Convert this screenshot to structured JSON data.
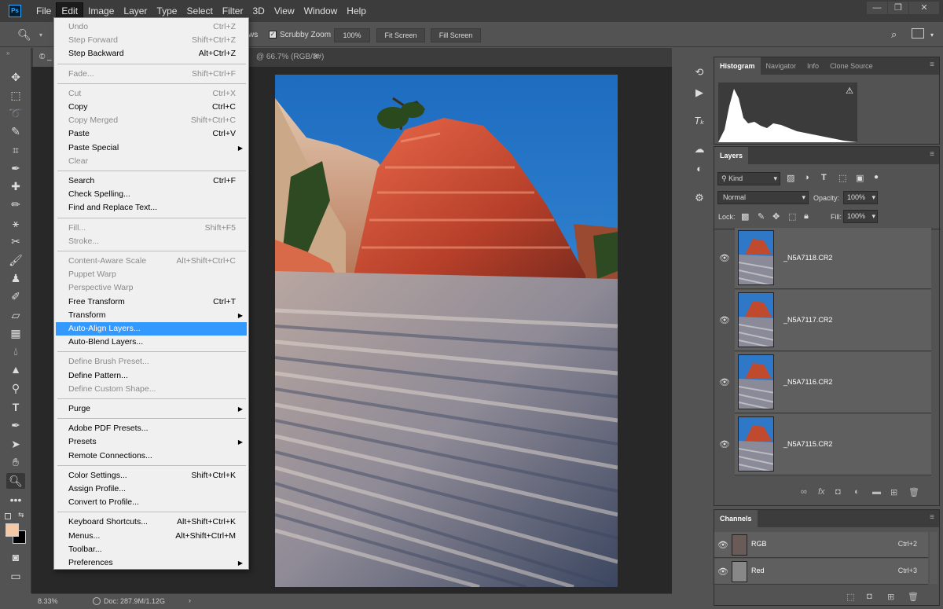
{
  "app": {
    "logo": "Ps"
  },
  "menubar": {
    "items": [
      "File",
      "Edit",
      "Image",
      "Layer",
      "Type",
      "Select",
      "Filter",
      "3D",
      "View",
      "Window",
      "Help"
    ],
    "active": "Edit"
  },
  "window_controls": {
    "minimize": "—",
    "maximize": "❐",
    "close": "✕"
  },
  "options": {
    "windows_label": "ws",
    "scrubby": "Scrubby Zoom",
    "zoom_pct": "100%",
    "fit": "Fit Screen",
    "fill": "Fill Screen"
  },
  "tabs": {
    "doc1": "© _",
    "doc2": "@ 66.7% (RGB/8#)",
    "close": "✕"
  },
  "status": {
    "zoom": "8.33%",
    "doc": "Doc: 287.9M/1.12G",
    "arrow": "›"
  },
  "edit_menu": [
    {
      "label": "Undo",
      "shortcut": "Ctrl+Z",
      "disabled": true
    },
    {
      "label": "Step Forward",
      "shortcut": "Shift+Ctrl+Z",
      "disabled": true
    },
    {
      "label": "Step Backward",
      "shortcut": "Alt+Ctrl+Z",
      "disabled": false
    },
    {
      "sep": true
    },
    {
      "label": "Fade...",
      "shortcut": "Shift+Ctrl+F",
      "disabled": true
    },
    {
      "sep": true
    },
    {
      "label": "Cut",
      "shortcut": "Ctrl+X",
      "disabled": true
    },
    {
      "label": "Copy",
      "shortcut": "Ctrl+C",
      "disabled": false
    },
    {
      "label": "Copy Merged",
      "shortcut": "Shift+Ctrl+C",
      "disabled": true
    },
    {
      "label": "Paste",
      "shortcut": "Ctrl+V",
      "disabled": false
    },
    {
      "label": "Paste Special",
      "shortcut": "",
      "disabled": false,
      "submenu": true
    },
    {
      "label": "Clear",
      "shortcut": "",
      "disabled": true
    },
    {
      "sep": true
    },
    {
      "label": "Search",
      "shortcut": "Ctrl+F",
      "disabled": false
    },
    {
      "label": "Check Spelling...",
      "shortcut": "",
      "disabled": false
    },
    {
      "label": "Find and Replace Text...",
      "shortcut": "",
      "disabled": false
    },
    {
      "sep": true
    },
    {
      "label": "Fill...",
      "shortcut": "Shift+F5",
      "disabled": true
    },
    {
      "label": "Stroke...",
      "shortcut": "",
      "disabled": true
    },
    {
      "sep": true
    },
    {
      "label": "Content-Aware Scale",
      "shortcut": "Alt+Shift+Ctrl+C",
      "disabled": true
    },
    {
      "label": "Puppet Warp",
      "shortcut": "",
      "disabled": true
    },
    {
      "label": "Perspective Warp",
      "shortcut": "",
      "disabled": true
    },
    {
      "label": "Free Transform",
      "shortcut": "Ctrl+T",
      "disabled": false
    },
    {
      "label": "Transform",
      "shortcut": "",
      "disabled": false,
      "submenu": true
    },
    {
      "label": "Auto-Align Layers...",
      "shortcut": "",
      "disabled": false,
      "highlighted": true
    },
    {
      "label": "Auto-Blend Layers...",
      "shortcut": "",
      "disabled": false
    },
    {
      "sep": true
    },
    {
      "label": "Define Brush Preset...",
      "shortcut": "",
      "disabled": true
    },
    {
      "label": "Define Pattern...",
      "shortcut": "",
      "disabled": false
    },
    {
      "label": "Define Custom Shape...",
      "shortcut": "",
      "disabled": true
    },
    {
      "sep": true
    },
    {
      "label": "Purge",
      "shortcut": "",
      "disabled": false,
      "submenu": true
    },
    {
      "sep": true
    },
    {
      "label": "Adobe PDF Presets...",
      "shortcut": "",
      "disabled": false
    },
    {
      "label": "Presets",
      "shortcut": "",
      "disabled": false,
      "submenu": true
    },
    {
      "label": "Remote Connections...",
      "shortcut": "",
      "disabled": false
    },
    {
      "sep": true
    },
    {
      "label": "Color Settings...",
      "shortcut": "Shift+Ctrl+K",
      "disabled": false
    },
    {
      "label": "Assign Profile...",
      "shortcut": "",
      "disabled": false
    },
    {
      "label": "Convert to Profile...",
      "shortcut": "",
      "disabled": false
    },
    {
      "sep": true
    },
    {
      "label": "Keyboard Shortcuts...",
      "shortcut": "Alt+Shift+Ctrl+K",
      "disabled": false
    },
    {
      "label": "Menus...",
      "shortcut": "Alt+Shift+Ctrl+M",
      "disabled": false
    },
    {
      "label": "Toolbar...",
      "shortcut": "",
      "disabled": false
    },
    {
      "label": "Preferences",
      "shortcut": "",
      "disabled": false,
      "submenu": true
    }
  ],
  "histogram_panel": {
    "tabs": [
      "Histogram",
      "Navigator",
      "Info",
      "Clone Source"
    ],
    "active": "Histogram",
    "warning": "⚠"
  },
  "layers_panel": {
    "tab": "Layers",
    "filter": "Kind",
    "blend_mode": "Normal",
    "opacity_label": "Opacity:",
    "opacity": "100%",
    "lock_label": "Lock:",
    "fill_label": "Fill:",
    "fill": "100%",
    "layers": [
      {
        "name": "_N5A7118.CR2"
      },
      {
        "name": "_N5A7117.CR2"
      },
      {
        "name": "_N5A7116.CR2"
      },
      {
        "name": "_N5A7115.CR2"
      }
    ]
  },
  "channels_panel": {
    "tab": "Channels",
    "channels": [
      {
        "name": "RGB",
        "shortcut": "Ctrl+2"
      },
      {
        "name": "Red",
        "shortcut": "Ctrl+3"
      }
    ]
  },
  "colors": {
    "accent": "#3399ff",
    "bg": "#535353",
    "menu_bg": "#f0f0f0",
    "foreground_swatch": "#f6c9a6",
    "background_swatch": "#000000"
  }
}
